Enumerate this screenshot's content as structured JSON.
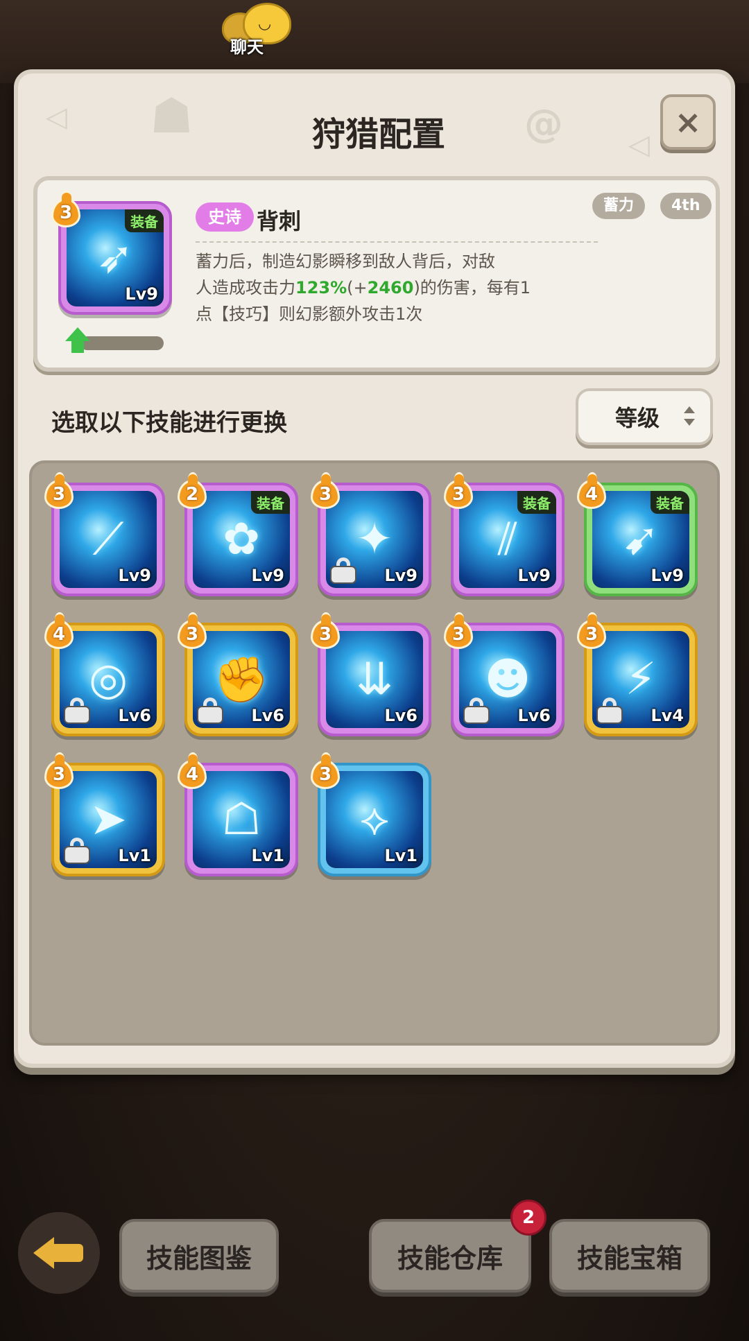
{
  "chat": {
    "label": "聊天"
  },
  "panel": {
    "title": "狩猎配置",
    "close_icon": "×"
  },
  "current_skill": {
    "badge": "3",
    "equip_label": "装备",
    "level": "Lv9",
    "rarity": "史诗",
    "name": "背刺",
    "tags": [
      "蓄力",
      "4th"
    ],
    "desc_1": "蓄力后，制造幻影瞬移到敌人背后，对敌",
    "desc_2a": "人造成攻击力",
    "desc_2b": "123%",
    "desc_2c": "(+",
    "desc_2d": "2460",
    "desc_2e": ")的伤害，每有1",
    "desc_3": "点【技巧】则幻影额外攻击1次"
  },
  "select": {
    "label": "选取以下技能进行更换",
    "sort_value": "等级"
  },
  "skills": [
    {
      "badge": "3",
      "level": "Lv9",
      "frame": "epic",
      "equipped": false,
      "locked": false,
      "icon": "triple-blades-icon"
    },
    {
      "badge": "2",
      "level": "Lv9",
      "frame": "epic",
      "equipped": true,
      "locked": false,
      "icon": "leaf-creature-icon"
    },
    {
      "badge": "3",
      "level": "Lv9",
      "frame": "epic",
      "equipped": false,
      "locked": true,
      "icon": "blade-fan-icon"
    },
    {
      "badge": "3",
      "level": "Lv9",
      "frame": "epic",
      "equipped": true,
      "locked": false,
      "icon": "slash-streaks-icon"
    },
    {
      "badge": "4",
      "level": "Lv9",
      "frame": "green",
      "equipped": true,
      "locked": false,
      "icon": "kunai-icon"
    },
    {
      "badge": "4",
      "level": "Lv6",
      "frame": "legend",
      "equipped": false,
      "locked": true,
      "icon": "orbit-swirl-icon"
    },
    {
      "badge": "3",
      "level": "Lv6",
      "frame": "legend",
      "equipped": false,
      "locked": true,
      "icon": "fist-punch-icon"
    },
    {
      "badge": "3",
      "level": "Lv6",
      "frame": "epic",
      "equipped": false,
      "locked": false,
      "icon": "falling-kunai-icon"
    },
    {
      "badge": "3",
      "level": "Lv6",
      "frame": "epic",
      "equipped": false,
      "locked": true,
      "icon": "shadow-figure-icon"
    },
    {
      "badge": "3",
      "level": "Lv4",
      "frame": "legend",
      "equipped": false,
      "locked": true,
      "icon": "lightning-blade-icon"
    },
    {
      "badge": "3",
      "level": "Lv1",
      "frame": "legend",
      "equipped": false,
      "locked": true,
      "icon": "dash-strike-icon"
    },
    {
      "badge": "4",
      "level": "Lv1",
      "frame": "epic",
      "equipped": false,
      "locked": false,
      "icon": "shadow-runner-icon"
    },
    {
      "badge": "3",
      "level": "Lv1",
      "frame": "rare",
      "equipped": false,
      "locked": false,
      "icon": "horn-thrust-icon"
    }
  ],
  "skill_equip_label": "装备",
  "bottom": {
    "codex": "技能图鉴",
    "warehouse": "技能仓库",
    "warehouse_badge": "2",
    "chest": "技能宝箱"
  },
  "colors": {
    "epic": "#d989e8",
    "legend": "#f1c23e",
    "rare": "#62c3ef",
    "green": "#8fe07c",
    "badge": "#f39b1f"
  }
}
